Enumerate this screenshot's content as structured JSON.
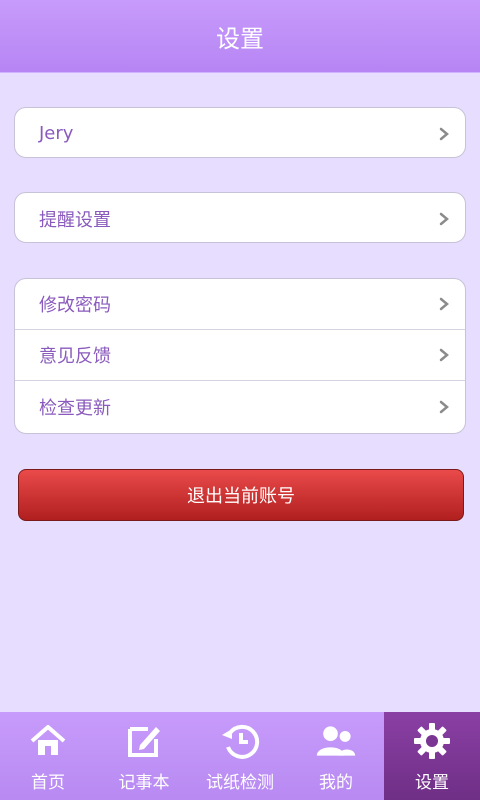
{
  "header": {
    "title": "设置"
  },
  "groups": {
    "account": {
      "label": "Jery"
    },
    "reminder": {
      "label": "提醒设置"
    },
    "misc": {
      "items": [
        {
          "label": "修改密码"
        },
        {
          "label": "意见反馈"
        },
        {
          "label": "检查更新"
        }
      ]
    }
  },
  "logout": {
    "label": "退出当前账号"
  },
  "tabs": [
    {
      "label": "首页",
      "icon": "home-icon"
    },
    {
      "label": "记事本",
      "icon": "edit-icon"
    },
    {
      "label": "试纸检测",
      "icon": "history-icon"
    },
    {
      "label": "我的",
      "icon": "users-icon"
    },
    {
      "label": "设置",
      "icon": "gear-icon",
      "active": true
    }
  ],
  "colors": {
    "accent": "#b785f4",
    "text": "#8a5bbd",
    "danger": "#d63232"
  }
}
